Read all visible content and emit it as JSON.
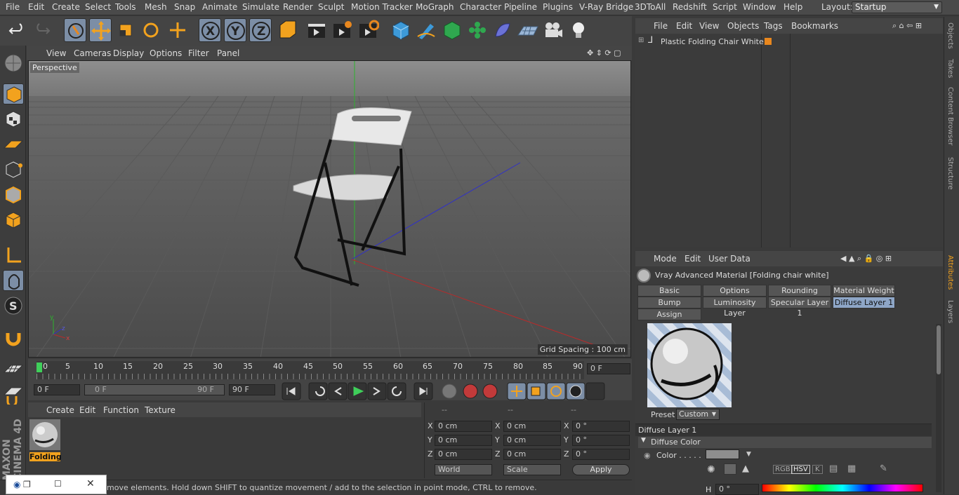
{
  "menubar": {
    "items": [
      "File",
      "Edit",
      "Create",
      "Select",
      "Tools",
      "Mesh",
      "Snap",
      "Animate",
      "Simulate",
      "Render",
      "Sculpt",
      "Motion Tracker",
      "MoGraph",
      "Character",
      "Pipeline",
      "Plugins",
      "V-Ray Bridge",
      "3DToAll",
      "Redshift",
      "Script",
      "Window",
      "Help"
    ],
    "layout_label": "Layout:",
    "layout_value": "Startup"
  },
  "toolbar_icons": [
    "undo-icon",
    "redo-icon",
    "live-select-icon",
    "move-icon",
    "scale-icon",
    "rotate-icon",
    "recent-tools-icon",
    "x-axis-icon",
    "y-axis-icon",
    "z-axis-icon",
    "coordinate-system-icon",
    "render-view-icon",
    "render-picture-viewer-icon",
    "render-settings-icon",
    "cube-icon",
    "pen-icon",
    "subdivision-icon",
    "cloner-icon",
    "deformer-icon",
    "floor-icon",
    "camera-icon",
    "light-icon"
  ],
  "viewport": {
    "menu": [
      "View",
      "Cameras",
      "Display",
      "Options",
      "Filter",
      "Panel"
    ],
    "camera_label": "Perspective",
    "grid_spacing": "Grid Spacing : 100 cm"
  },
  "timeline": {
    "ticks": [
      "0",
      "5",
      "10",
      "15",
      "20",
      "25",
      "30",
      "35",
      "40",
      "45",
      "50",
      "55",
      "60",
      "65",
      "70",
      "75",
      "80",
      "85",
      "90"
    ],
    "current_frame": "0 F",
    "start_frame": "0 F",
    "range_start": "0 F",
    "range_end": "90 F",
    "end_frame": "90 F"
  },
  "material_manager": {
    "menu": [
      "Create",
      "Edit",
      "Function",
      "Texture"
    ],
    "material_name": "Folding"
  },
  "coordinates": {
    "headers": [
      "--",
      "--",
      "--"
    ],
    "rows": [
      {
        "axis": "X",
        "pos": "0 cm",
        "size_axis": "X",
        "size": "0 cm",
        "rot_axis": "H",
        "rot": "0 °"
      },
      {
        "axis": "Y",
        "pos": "0 cm",
        "size_axis": "Y",
        "size": "0 cm",
        "rot_axis": "P",
        "rot": "0 °"
      },
      {
        "axis": "Z",
        "pos": "0 cm",
        "size_axis": "Z",
        "size": "0 cm",
        "rot_axis": "B",
        "rot": "0 °"
      }
    ],
    "rot_axis_labels": [
      "X",
      "Y",
      "Z"
    ],
    "mode_world": "World",
    "mode_scale": "Scale",
    "apply": "Apply"
  },
  "status_text": "move elements. Hold down SHIFT to quantize movement / add to the selection in point mode, CTRL to remove.",
  "object_manager": {
    "menu": [
      "File",
      "Edit",
      "View",
      "Objects",
      "Tags",
      "Bookmarks"
    ],
    "object_name": "Plastic Folding Chair White"
  },
  "attribute_manager": {
    "menu": [
      "Mode",
      "Edit",
      "User Data"
    ],
    "title": "Vray Advanced Material [Folding chair white]",
    "tabs_row1": [
      "Basic",
      "Options",
      "Rounding",
      "Material Weight"
    ],
    "tabs_row2": [
      "Bump",
      "Luminosity Layer",
      "Specular Layer 1",
      "Diffuse Layer 1"
    ],
    "tabs_row3": [
      "Assign"
    ],
    "preset_label": "Preset",
    "preset_value": "Custom",
    "section": "Diffuse Layer 1",
    "subsection": "Diffuse Color",
    "color_label": "Color . . . . .",
    "color_modes": [
      "RGB",
      "HSV",
      "K"
    ],
    "h_label": "H",
    "h_value": "0 °"
  },
  "right_tabs": [
    "Objects",
    "Takes",
    "Content Browser",
    "Structure",
    "Attributes",
    "Layers"
  ],
  "branding": "MAXON CINEMA 4D",
  "colors": {
    "accent": "#8ea6c7",
    "selected": "#7c8ea6",
    "orange": "#e8871e"
  }
}
